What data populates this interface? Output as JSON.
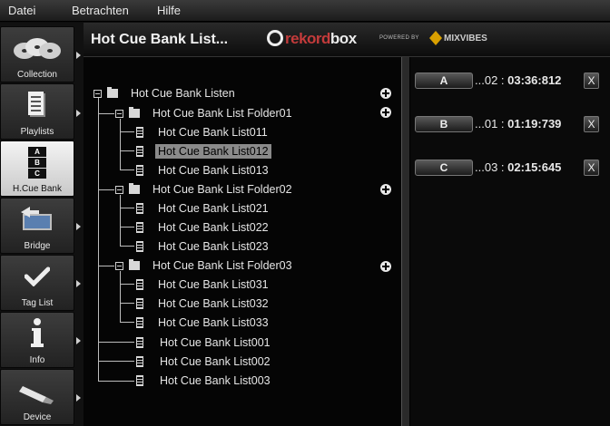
{
  "menu": [
    "Datei",
    "Betrachten",
    "Hilfe"
  ],
  "header": {
    "title": "Hot Cue Bank List...",
    "logo_rekord": "rekord",
    "logo_box": "box",
    "powered_by": "POWERED BY",
    "mixvibes": "MIXVIBES"
  },
  "sidebar": [
    {
      "label": "Collection",
      "icon": "collection-icon",
      "active": false
    },
    {
      "label": "Playlists",
      "icon": "playlists-icon",
      "active": false
    },
    {
      "label": "H.Cue Bank",
      "icon": "hot-cue-bank-icon",
      "active": true,
      "icon_letters": [
        "A",
        "B",
        "C"
      ]
    },
    {
      "label": "Bridge",
      "icon": "bridge-icon",
      "active": false
    },
    {
      "label": "Tag List",
      "icon": "check-icon",
      "active": false
    },
    {
      "label": "Info",
      "icon": "info-icon",
      "active": false
    },
    {
      "label": "Device",
      "icon": "usb-device-icon",
      "active": false
    }
  ],
  "tree": {
    "root": "Hot Cue Bank Listen",
    "folder1": "Hot Cue Bank List Folder01",
    "f1_items": [
      "Hot Cue Bank List011",
      "Hot Cue Bank List012",
      "Hot Cue Bank List013"
    ],
    "folder2": "Hot Cue Bank List Folder02",
    "f2_items": [
      "Hot Cue Bank List021",
      "Hot Cue Bank List022",
      "Hot Cue Bank List023"
    ],
    "folder3": "Hot Cue Bank List Folder03",
    "f3_items": [
      "Hot Cue Bank List031",
      "Hot Cue Bank List032",
      "Hot Cue Bank List033"
    ],
    "root_items": [
      "Hot Cue Bank List001",
      "Hot Cue Bank List002",
      "Hot Cue Bank List003"
    ],
    "selected": "Hot Cue Bank List012"
  },
  "cues": [
    {
      "key": "A",
      "prefix": "...02 : ",
      "time": "03:36:812",
      "remove": "X"
    },
    {
      "key": "B",
      "prefix": "...01 : ",
      "time": "01:19:739",
      "remove": "X"
    },
    {
      "key": "C",
      "prefix": "...03 : ",
      "time": "02:15:645",
      "remove": "X"
    }
  ]
}
